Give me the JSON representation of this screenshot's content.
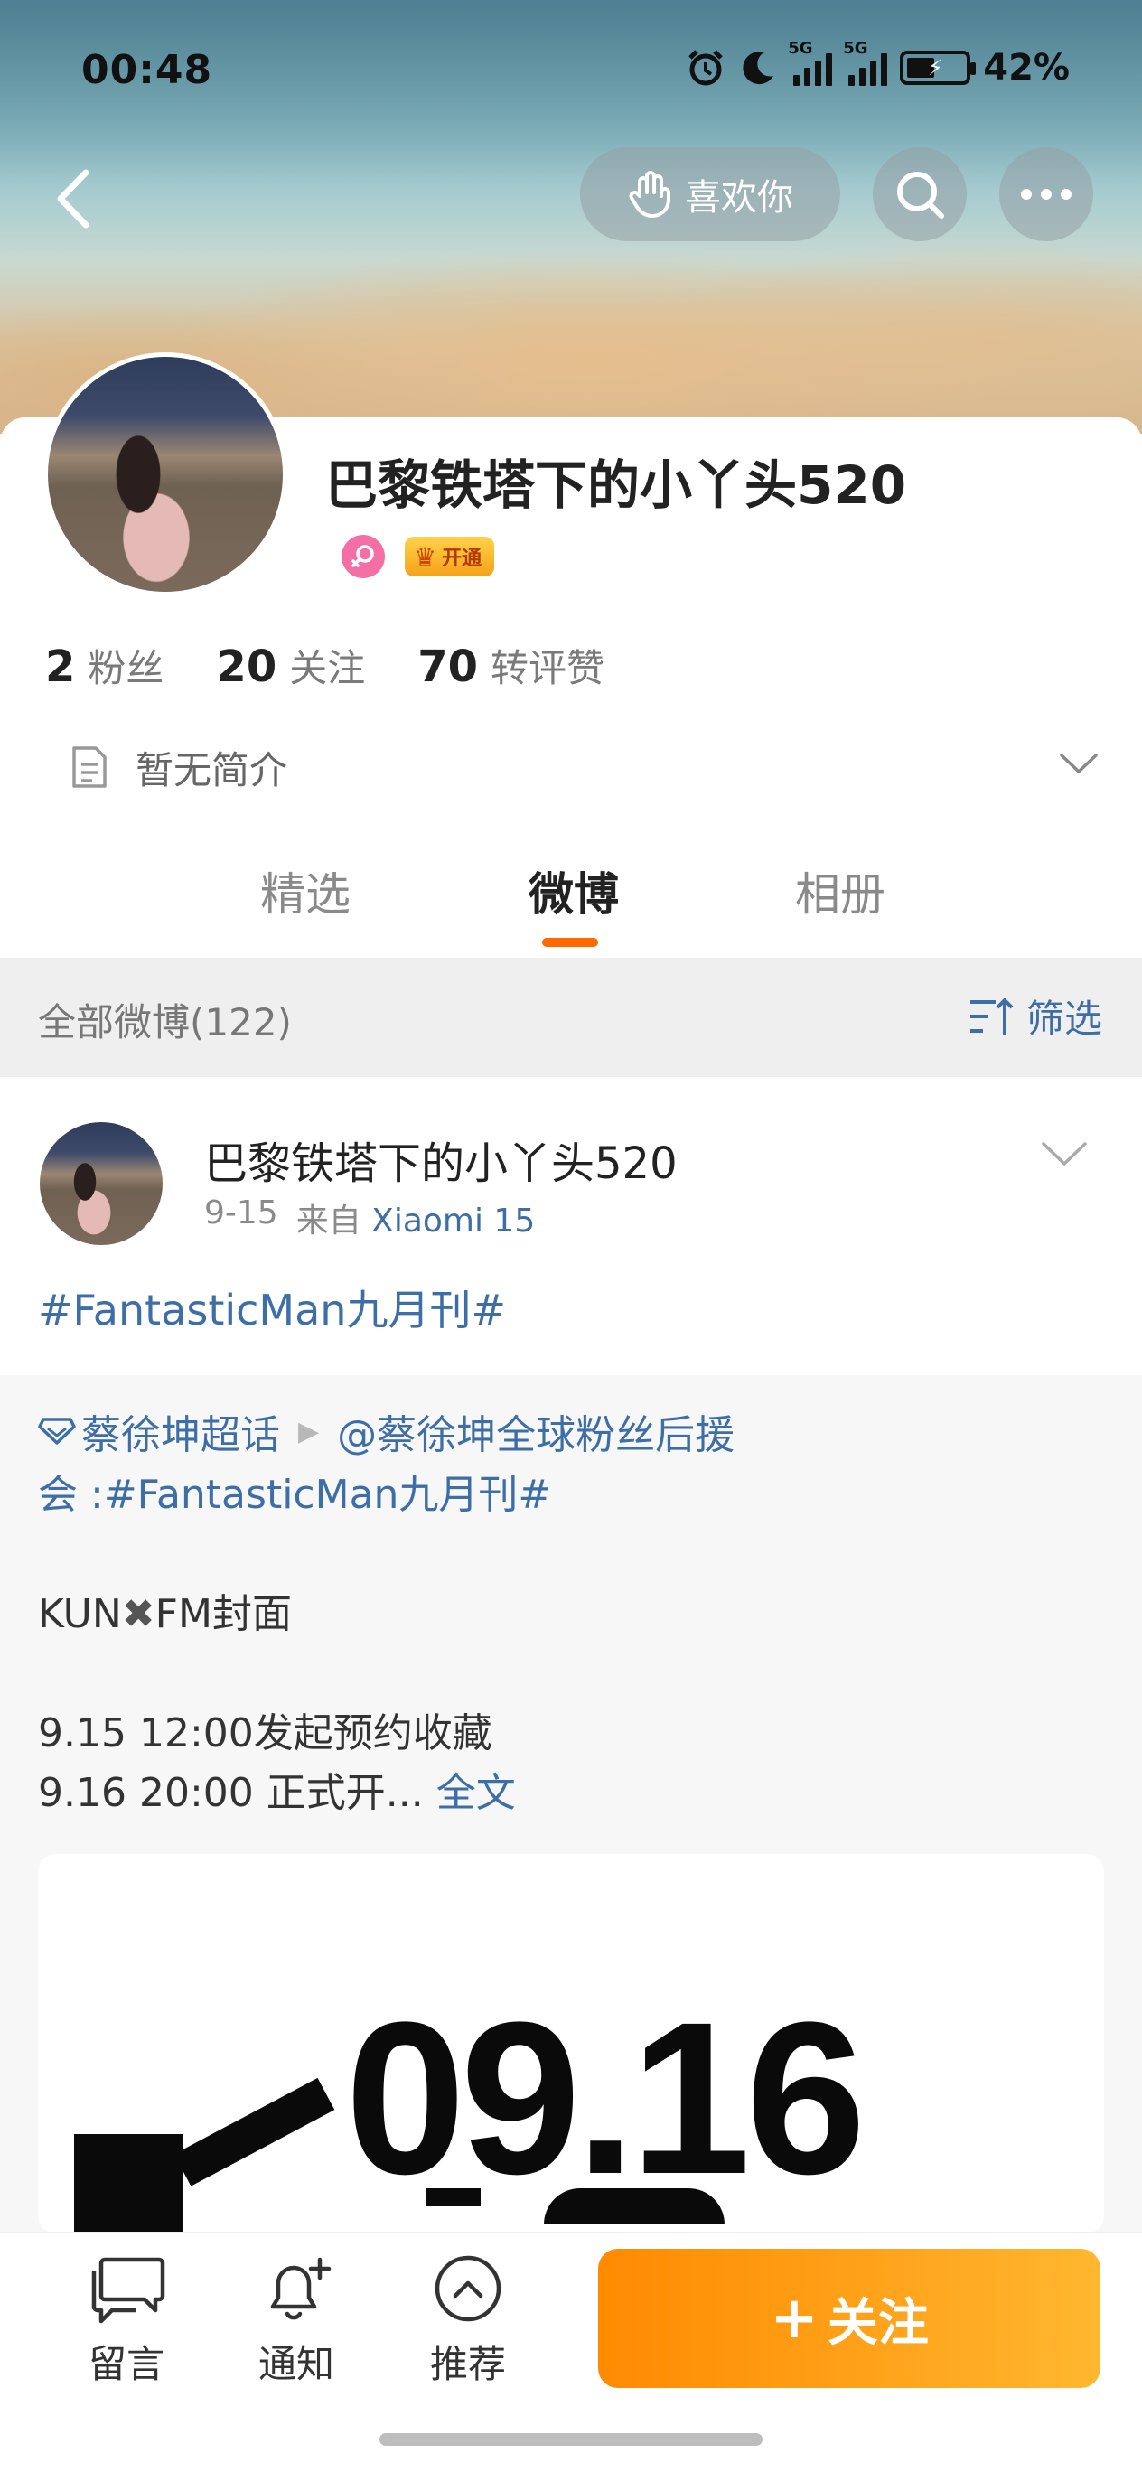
{
  "status_bar": {
    "time": "00:48",
    "network_1": "5G",
    "network_2": "5G",
    "battery": "42%"
  },
  "header": {
    "like_button": "喜欢你"
  },
  "profile": {
    "name": "巴黎铁塔下的小丫头520",
    "vip_badge": "开通",
    "stats": [
      {
        "number": "2",
        "label": "粉丝"
      },
      {
        "number": "20",
        "label": "关注"
      },
      {
        "number": "70",
        "label": "转评赞"
      }
    ],
    "bio": "暂无简介"
  },
  "tabs": [
    {
      "label": "精选",
      "active": false
    },
    {
      "label": "微博",
      "active": true
    },
    {
      "label": "相册",
      "active": false
    }
  ],
  "filter": {
    "count_label": "全部微博(122)",
    "filter_label": "筛选"
  },
  "post": {
    "author": "巴黎铁塔下的小丫头520",
    "date": "9-15",
    "source_prefix": "来自",
    "device": "Xiaomi 15",
    "topic": "#FantasticMan九月刊#",
    "repost": {
      "supertopic": "蔡徐坤超话",
      "mention": "@蔡徐坤全球粉丝后援",
      "line2_prefix": "会 :",
      "line2_topic": "#FantasticMan九月刊#",
      "line3_a": "KUN",
      "line3_x": "✖",
      "line3_b": "FM封面",
      "line4": "9.15 12:00发起预约收藏",
      "line5": "9.16 20:00 正式开...",
      "full_text_link": "全文",
      "image_text": "09.16"
    }
  },
  "bottom_bar": {
    "items": [
      {
        "label": "留言",
        "icon": "comment-icon"
      },
      {
        "label": "通知",
        "icon": "bell-plus-icon"
      },
      {
        "label": "推荐",
        "icon": "chevron-up-circle-icon"
      }
    ],
    "follow_label": "关注"
  },
  "colors": {
    "accent": "#ff6a00",
    "link": "#3e6ea6",
    "follow_gradient_start": "#ff8a00",
    "follow_gradient_end": "#ffb730"
  }
}
